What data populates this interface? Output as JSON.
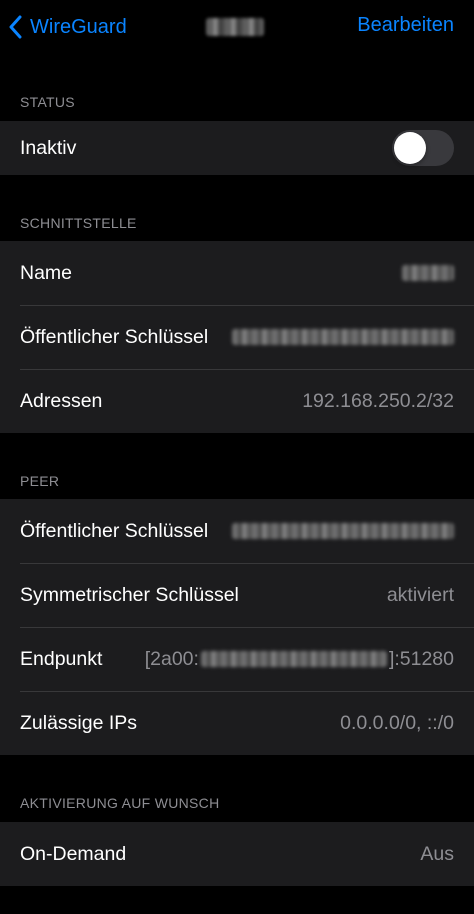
{
  "nav": {
    "back_label": "WireGuard",
    "edit_label": "Bearbeiten"
  },
  "status": {
    "header": "STATUS",
    "label": "Inaktiv",
    "toggle_on": false
  },
  "interface": {
    "header": "SCHNITTSTELLE",
    "name_label": "Name",
    "public_key_label": "Öffentlicher Schlüssel",
    "addresses_label": "Adressen",
    "addresses_value": "192.168.250.2/32"
  },
  "peer": {
    "header": "PEER",
    "public_key_label": "Öffentlicher Schlüssel",
    "psk_label": "Symmetrischer Schlüssel",
    "psk_value": "aktiviert",
    "endpoint_label": "Endpunkt",
    "endpoint_prefix": "[2a00:",
    "endpoint_suffix": "]:51280",
    "allowed_ips_label": "Zulässige IPs",
    "allowed_ips_value": "0.0.0.0/0, ::/0"
  },
  "on_demand": {
    "header": "AKTIVIERUNG AUF WUNSCH",
    "label": "On-Demand",
    "value": "Aus"
  },
  "colors": {
    "accent": "#0a84ff",
    "background": "#000000",
    "cell": "#1c1c1e",
    "secondary_text": "#8e8e93"
  }
}
